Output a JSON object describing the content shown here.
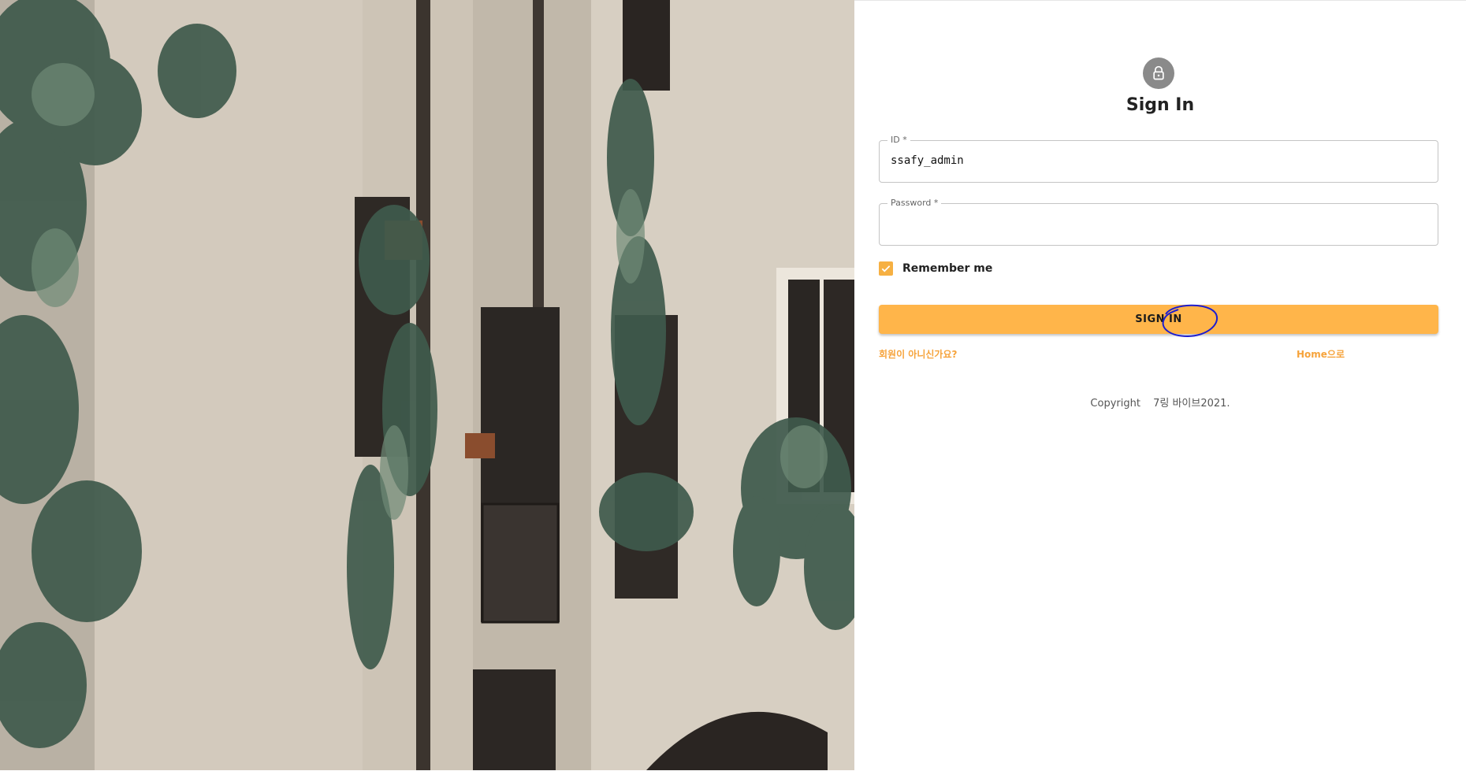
{
  "page": {
    "title": "Sign In"
  },
  "form": {
    "id": {
      "label": "ID *",
      "value": "ssafy_admin"
    },
    "password": {
      "label": "Password *",
      "value": ""
    },
    "remember": {
      "label": "Remember me",
      "checked": true
    },
    "submit_label": "SIGN IN"
  },
  "links": {
    "signup": "회원이 아니신가요?",
    "home": "Home으로"
  },
  "footer": {
    "copyright_prefix": "Copyright",
    "copyright_text": "7링 바이브2021."
  },
  "colors": {
    "accent": "#ffb54a",
    "link": "#f6a33b",
    "avatar_bg": "#8a8a8a",
    "annotation_circle": "#1d1dcf"
  },
  "icons": {
    "avatar": "lock-icon",
    "checkbox": "check-icon"
  }
}
